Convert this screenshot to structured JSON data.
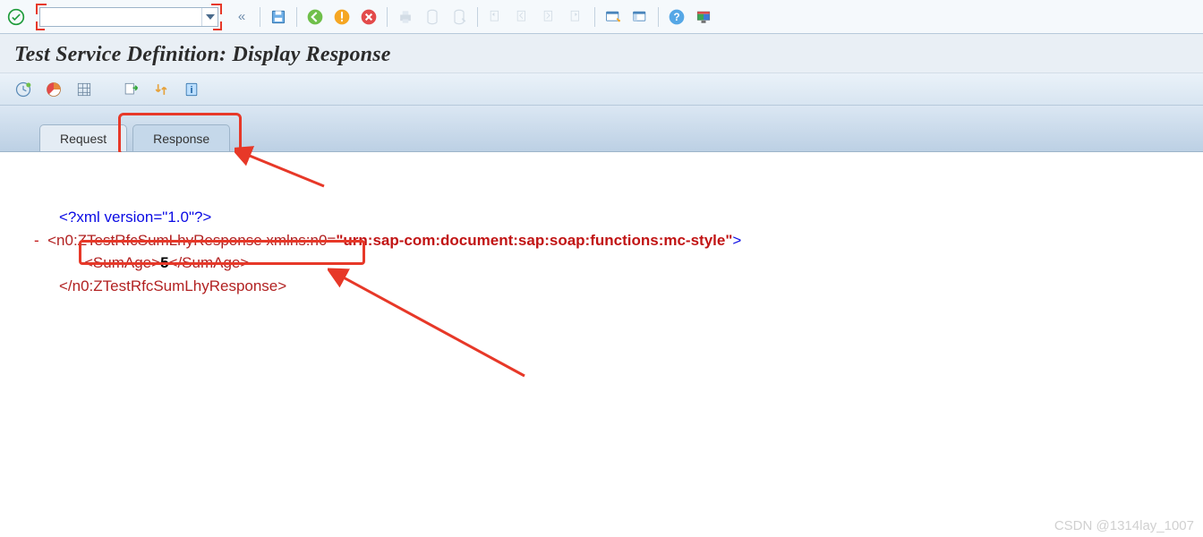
{
  "toolbar": {
    "transaction_value": "",
    "transaction_placeholder": ""
  },
  "title": "Test Service Definition: Display Response",
  "tabs": [
    {
      "id": "request",
      "label": "Request",
      "active": false
    },
    {
      "id": "response",
      "label": "Response",
      "active": true
    }
  ],
  "xml": {
    "declaration": "<?xml version=\"1.0\"?>",
    "root_open_prefix": "<n0:ZTestRfcSumLhyResponse",
    "root_ns_attr": " xmlns:n0=",
    "root_ns_value": "\"urn:sap-com:document:sap:soap:functions:mc-style\"",
    "root_open_suffix": ">",
    "child_open": "<SumAge>",
    "child_value": "5",
    "child_close": "</SumAge>",
    "root_close": "</n0:ZTestRfcSumLhyResponse>"
  },
  "watermark": "CSDN @1314lay_1007"
}
